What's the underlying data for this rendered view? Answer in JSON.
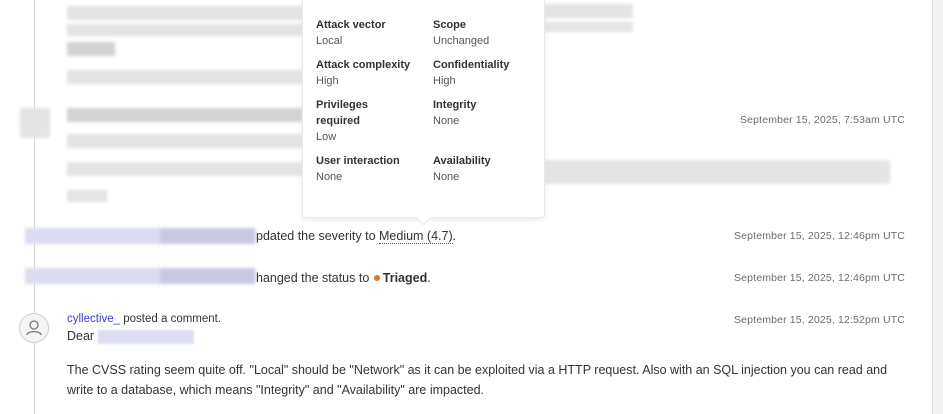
{
  "popover": {
    "metrics": [
      {
        "label": "Attack vector",
        "value": "Local"
      },
      {
        "label": "Scope",
        "value": "Unchanged"
      },
      {
        "label": "Attack complexity",
        "value": "High"
      },
      {
        "label": "Confidentiality",
        "value": "High"
      },
      {
        "label": "Privileges required",
        "value": "Low"
      },
      {
        "label": "Integrity",
        "value": "None"
      },
      {
        "label": "User interaction",
        "value": "None"
      },
      {
        "label": "Availability",
        "value": "None"
      }
    ]
  },
  "timestamps": {
    "first": "September 15, 2025, 7:53am UTC",
    "severity": "September 15, 2025, 12:46pm UTC",
    "status": "September 15, 2025, 12:46pm UTC",
    "comment": "September 15, 2025, 12:52pm UTC"
  },
  "severity_activity": {
    "prefix": "pdated the severity to ",
    "severity": "Medium (4.7)",
    "suffix": "."
  },
  "status_activity": {
    "prefix": "hanged the status to ",
    "status": "Triaged",
    "suffix": ".",
    "status_color": "#e0781f"
  },
  "comment": {
    "username": "cyllective_",
    "action": " posted a comment.",
    "greeting": "Dear",
    "body": "The CVSS rating seem quite off. \"Local\" should be \"Network\" as it can be exploited via a HTTP request. Also with an SQL injection you can read and write to a database, which means \"Integrity\" and \"Availability\" are impacted."
  },
  "icons": {
    "avatar": "user-icon"
  }
}
